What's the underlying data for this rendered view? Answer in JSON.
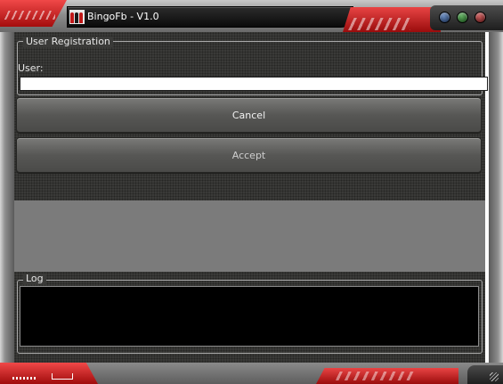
{
  "window": {
    "title": "BingoFb - V1.0"
  },
  "registration": {
    "group_title": "User Registration",
    "user_label": "User:",
    "user_value": "",
    "cancel_label": "Cancel",
    "accept_label": "Accept"
  },
  "log": {
    "group_title": "Log",
    "content": ""
  },
  "title_buttons": [
    "minimize-orb-icon",
    "maximize-orb-icon",
    "close-orb-icon"
  ],
  "colors": {
    "accent_red": "#d42020",
    "panel_dark": "#3a3a38",
    "button_gray": "#575755",
    "log_background": "#000000"
  }
}
